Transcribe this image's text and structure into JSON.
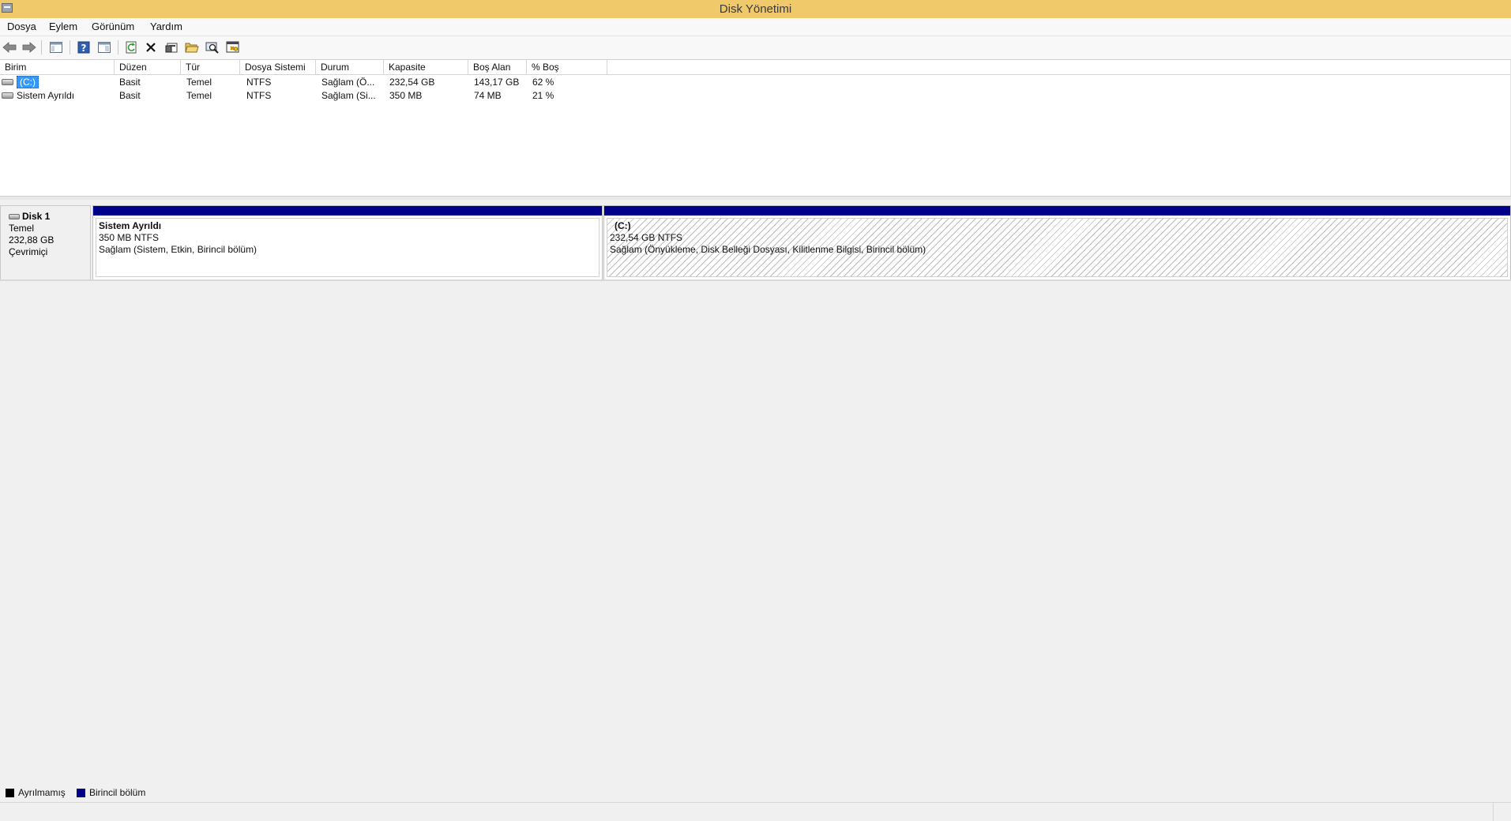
{
  "window": {
    "title": "Disk Yönetimi"
  },
  "menu": {
    "items": [
      "Dosya",
      "Eylem",
      "Görünüm",
      "Yardım"
    ]
  },
  "toolbar": {
    "buttons": [
      "back-icon",
      "forward-icon",
      "console-tree-icon",
      "help-icon",
      "show-hide-icon",
      "refresh-icon",
      "delete-icon",
      "properties-icon",
      "open-icon",
      "explore-icon",
      "settings-icon"
    ]
  },
  "volumes": {
    "headers": [
      "Birim",
      "Düzen",
      "Tür",
      "Dosya Sistemi",
      "Durum",
      "Kapasite",
      "Boş Alan",
      "% Boş"
    ],
    "rows": [
      [
        "(C:)",
        "Basit",
        "Temel",
        "NTFS",
        "Sağlam (Ö...",
        "232,54 GB",
        "143,17 GB",
        "62 %"
      ],
      [
        "Sistem Ayrıldı",
        "Basit",
        "Temel",
        "NTFS",
        "Sağlam (Si...",
        "350 MB",
        "74 MB",
        "21 %"
      ]
    ]
  },
  "disk": {
    "name": "Disk 1",
    "type": "Temel",
    "size": "232,88 GB",
    "status": "Çevrimiçi",
    "partitions": [
      {
        "name": "Sistem Ayrıldı",
        "size_fs": "350 MB NTFS",
        "status": "Sağlam (Sistem, Etkin, Birincil bölüm)"
      },
      {
        "name": "(C:)",
        "size_fs": "232,54 GB NTFS",
        "status": "Sağlam (Önyükleme, Disk Belleği Dosyası, Kilitlenme Bilgisi, Birincil bölüm)"
      }
    ]
  },
  "legend": {
    "items": [
      {
        "label": "Ayrılmamış",
        "color": "#000000"
      },
      {
        "label": "Birincil bölüm",
        "color": "#00008b"
      }
    ]
  },
  "colors": {
    "titlebar": "#f0c96a",
    "primary_partition": "#00008b",
    "selection": "#3399ff"
  }
}
